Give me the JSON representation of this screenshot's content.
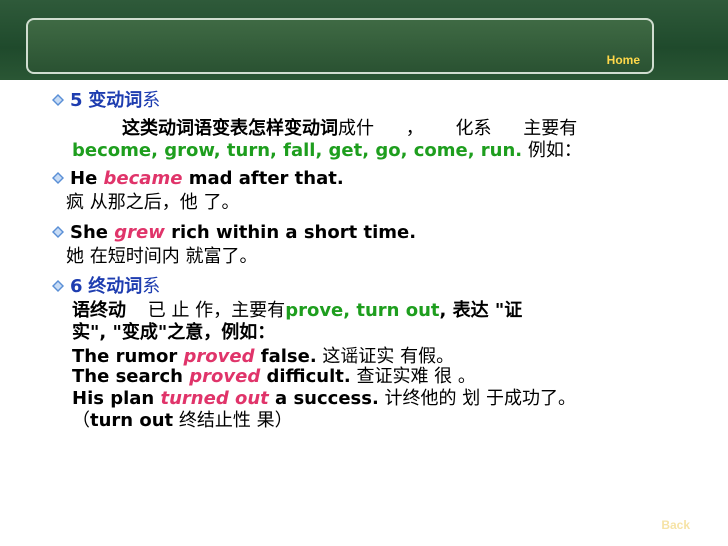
{
  "header": {
    "home_label": "Home"
  },
  "footer": {
    "back_label": "Back"
  },
  "items": [
    {
      "num": "5",
      "title": "变动词",
      "title_suffix": "系"
    },
    {
      "text_a": "这类",
      "text_b": "动词语变表怎样变动词",
      "text_c": "成什",
      "text_d": "，",
      "text_e": "化系",
      "text_f": "主要有"
    },
    {
      "verbs": "become, grow, turn, fall, get, go, come, run.",
      "tail": " 例如："
    },
    {
      "en_a": "He ",
      "verb": "became",
      "en_b": " mad after that."
    },
    {
      "cn": "疯 从那之后，他 了。"
    },
    {
      "en_a": "She ",
      "verb": "grew",
      "en_b": " rich within a short time."
    },
    {
      "cn": "她 在短时间内 就富了。"
    },
    {
      "num": "6",
      "title": "终动词",
      "title_suffix": "系"
    },
    {
      "cn_a": "语终动",
      "cn_b": "已 止 作，主要有",
      "verbs": "prove, turn out",
      "cn_c": ", 表达 \"证"
    },
    {
      "cn_a": "实\", \"变成\"之意，例如："
    },
    {
      "en_a": "The rumor ",
      "verb": "proved",
      "en_b": " false.",
      "cn": " 这谣证实 有假。"
    },
    {
      "en_a": "The search ",
      "verb": "proved",
      "en_b": " difficult.",
      "cn": " 查证实难 很 。"
    },
    {
      "en_a": "His plan ",
      "verb": "turned out",
      "en_b": " a success.",
      "cn": " 计终他的 划 于成功了。"
    },
    {
      "cn_a": "（",
      "en": "turn out",
      "cn_b": " 终结止性 果）"
    }
  ],
  "colors": {
    "header": "#1f4a2c",
    "heading": "#1e3db0",
    "verb_highlight": "#e0346a",
    "verb_list": "#1e9e1e"
  },
  "icons": [
    "diamond-bullet-icon"
  ]
}
